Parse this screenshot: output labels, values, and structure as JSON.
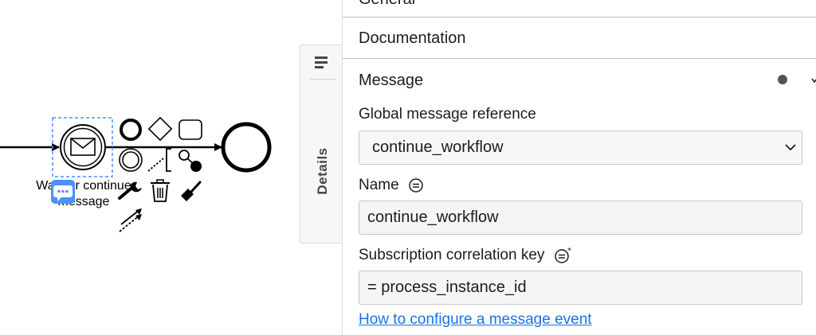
{
  "diagram": {
    "start_event_label": "Wait for continue message"
  },
  "sidebar_tab": {
    "label": "Details"
  },
  "panel": {
    "groups": {
      "general": "General",
      "documentation": "Documentation",
      "message": "Message"
    },
    "message": {
      "global_ref_label": "Global message reference",
      "global_ref_value": "continue_workflow",
      "name_label": "Name",
      "name_value": "continue_workflow",
      "correlation_label": "Subscription correlation key",
      "correlation_value": "= process_instance_id",
      "help_link": "How to configure a message event"
    }
  },
  "colors": {
    "link": "#1a73e8",
    "selection": "#4d90fe",
    "comment_badge": "#4d90fe"
  }
}
